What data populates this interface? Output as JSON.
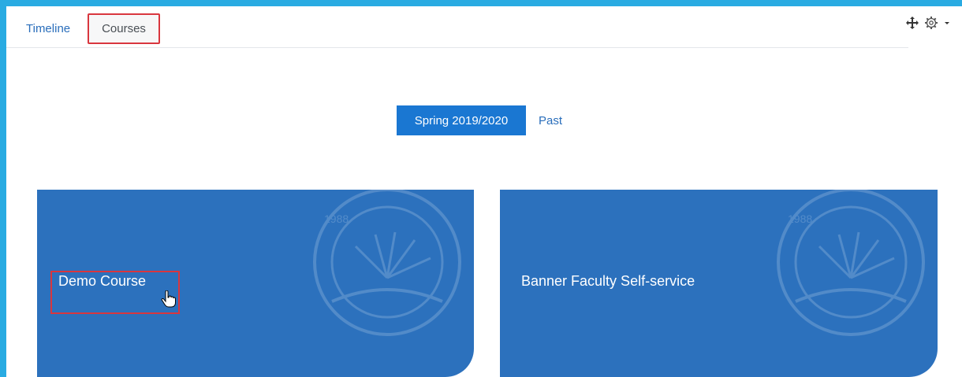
{
  "tabs": {
    "timeline": "Timeline",
    "courses": "Courses"
  },
  "filter": {
    "active": "Spring 2019/2020",
    "other": "Past"
  },
  "courses": [
    {
      "name": "Demo Course"
    },
    {
      "name": "Banner Faculty Self-service"
    }
  ],
  "watermark_text": "1988",
  "colors": {
    "card": "#2c71bd",
    "accent": "#1a77d2",
    "highlight": "#d9363e",
    "border": "#29abe2"
  }
}
